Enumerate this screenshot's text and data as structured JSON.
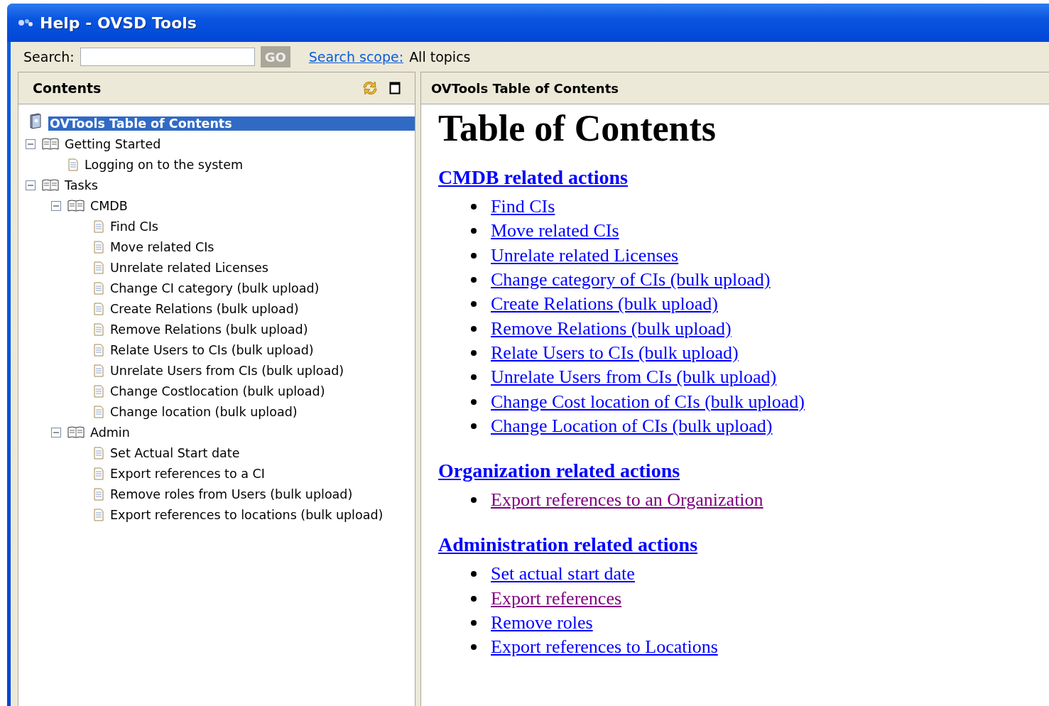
{
  "window": {
    "title": "Help - OVSD Tools"
  },
  "search": {
    "label": "Search:",
    "button": "GO",
    "scope_link": "Search scope:",
    "scope_value": "All topics"
  },
  "contents_pane": {
    "title": "Contents",
    "tree": [
      {
        "kind": "root",
        "label": "OVTools Table of Contents",
        "selected": true,
        "children": [
          {
            "kind": "book",
            "label": "Getting Started",
            "expanded": true,
            "selected": false,
            "children": [
              {
                "kind": "page",
                "label": "Logging on to the system",
                "selected": false
              }
            ]
          },
          {
            "kind": "book",
            "label": "Tasks",
            "expanded": true,
            "selected": false,
            "children": [
              {
                "kind": "book",
                "label": "CMDB",
                "expanded": true,
                "selected": false,
                "children": [
                  {
                    "kind": "page",
                    "label": "Find CIs",
                    "selected": false
                  },
                  {
                    "kind": "page",
                    "label": "Move related CIs",
                    "selected": false
                  },
                  {
                    "kind": "page",
                    "label": "Unrelate related Licenses",
                    "selected": false
                  },
                  {
                    "kind": "page",
                    "label": "Change CI category (bulk upload)",
                    "selected": false
                  },
                  {
                    "kind": "page",
                    "label": "Create Relations (bulk upload)",
                    "selected": false
                  },
                  {
                    "kind": "page",
                    "label": "Remove Relations (bulk upload)",
                    "selected": false
                  },
                  {
                    "kind": "page",
                    "label": "Relate Users to CIs (bulk upload)",
                    "selected": false
                  },
                  {
                    "kind": "page",
                    "label": "Unrelate Users from CIs (bulk upload)",
                    "selected": false
                  },
                  {
                    "kind": "page",
                    "label": "Change Costlocation (bulk upload)",
                    "selected": false
                  },
                  {
                    "kind": "page",
                    "label": "Change location (bulk upload)",
                    "selected": false
                  }
                ]
              },
              {
                "kind": "book",
                "label": "Admin",
                "expanded": true,
                "selected": false,
                "children": [
                  {
                    "kind": "page",
                    "label": "Set Actual Start date",
                    "selected": false
                  },
                  {
                    "kind": "page",
                    "label": "Export references to a CI",
                    "selected": false
                  },
                  {
                    "kind": "page",
                    "label": "Remove roles from Users (bulk upload)",
                    "selected": false
                  },
                  {
                    "kind": "page",
                    "label": "Export references to locations (bulk upload)",
                    "selected": false
                  }
                ]
              }
            ]
          }
        ]
      }
    ]
  },
  "content_pane": {
    "title": "OVTools Table of Contents",
    "heading": "Table of Contents",
    "sections": [
      {
        "title": "CMDB related actions",
        "links": [
          {
            "text": "Find CIs",
            "visited": false
          },
          {
            "text": "Move related CIs",
            "visited": false
          },
          {
            "text": "Unrelate related Licenses",
            "visited": false
          },
          {
            "text": "Change category of CIs (bulk upload)",
            "visited": false
          },
          {
            "text": "Create Relations (bulk upload)",
            "visited": false
          },
          {
            "text": "Remove Relations (bulk upload)",
            "visited": false
          },
          {
            "text": "Relate Users to CIs (bulk upload)",
            "visited": false
          },
          {
            "text": "Unrelate Users from CIs (bulk upload)",
            "visited": false
          },
          {
            "text": "Change Cost location of CIs (bulk upload)",
            "visited": false
          },
          {
            "text": "Change Location of CIs (bulk upload)",
            "visited": false
          }
        ]
      },
      {
        "title": "Organization related actions",
        "links": [
          {
            "text": "Export references to an Organization",
            "visited": true
          }
        ]
      },
      {
        "title": "Administration related actions",
        "links": [
          {
            "text": "Set actual start date",
            "visited": false
          },
          {
            "text": "Export references",
            "visited": true
          },
          {
            "text": "Remove roles",
            "visited": false
          },
          {
            "text": "Export references to Locations",
            "visited": false
          }
        ]
      }
    ]
  }
}
